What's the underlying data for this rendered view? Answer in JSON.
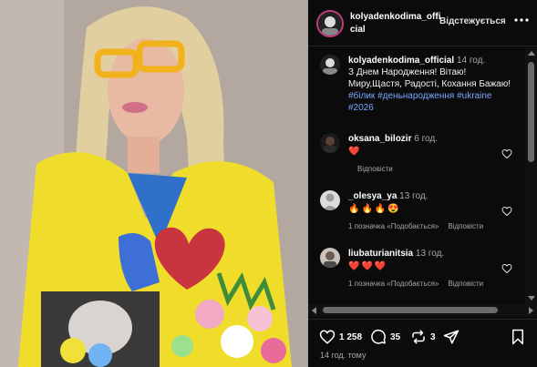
{
  "post": {
    "username": "kolyadenkodima_official",
    "follow_label": "Відстежується",
    "caption_time": "14 год.",
    "caption_text": "З Днем Народження! Вітаю! Миру,Щастя, Радості, Кохання Бажаю!",
    "caption_tags": "#білик #деньнародження #ukraine #2026",
    "age": "14 год. тому"
  },
  "comments": [
    {
      "username": "oksana_bilozir",
      "time": "6 год.",
      "text": "❤️",
      "likes": "",
      "reply": "Відповісти"
    },
    {
      "username": "_olesya_ya",
      "time": "13 год.",
      "text": "🔥🔥🔥😍",
      "likes": "1 позначка «Подобається»",
      "reply": "Відповісти"
    },
    {
      "username": "liubaturianitsia",
      "time": "13 год.",
      "text": "❤️❤️❤️",
      "likes": "1 позначка «Подобається»",
      "reply": "Відповісти"
    }
  ],
  "actions": {
    "likes": "1 258",
    "comments": "35",
    "reposts": "3"
  },
  "icons": [
    "more-icon",
    "heart-icon",
    "comment-icon",
    "repost-icon",
    "share-icon",
    "bookmark-icon"
  ],
  "colors": {
    "panel_bg": "#0b0b0b",
    "tag": "#7aa7ff",
    "ring": "#c23a7c"
  }
}
